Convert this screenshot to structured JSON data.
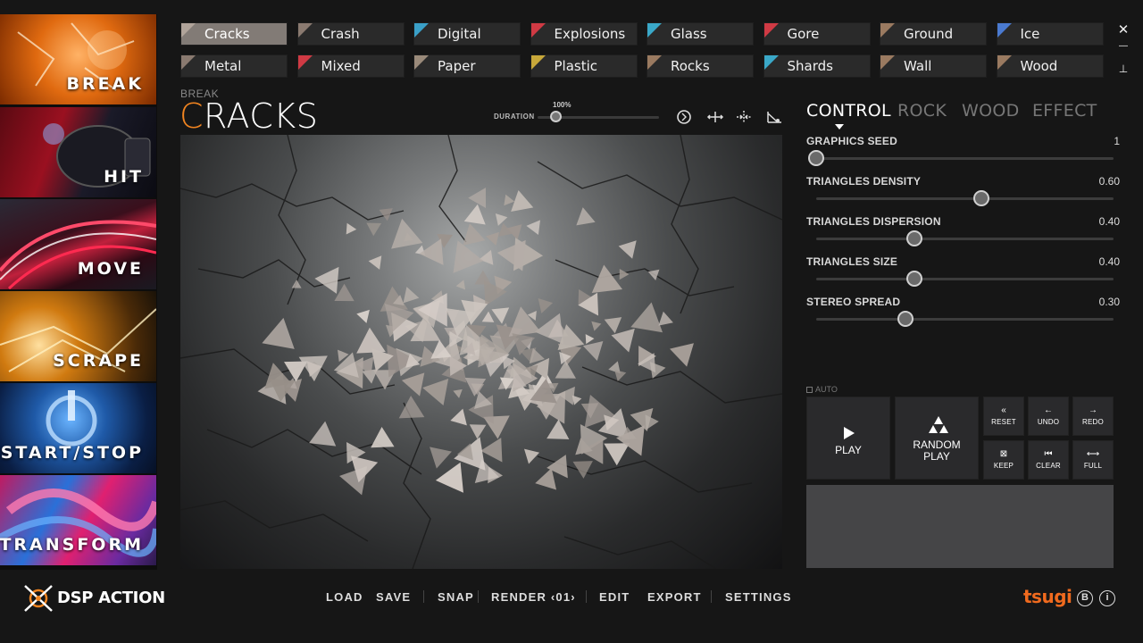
{
  "sidebar": {
    "categories": [
      {
        "label": "BREAK"
      },
      {
        "label": "HIT"
      },
      {
        "label": "MOVE"
      },
      {
        "label": "SCRAPE"
      },
      {
        "label": "START/STOP"
      },
      {
        "label": "TRANSFORM"
      }
    ]
  },
  "presets": [
    {
      "label": "Cracks",
      "color": "#b0a49a",
      "active": true
    },
    {
      "label": "Crash",
      "color": "#8a7a70"
    },
    {
      "label": "Digital",
      "color": "#3aa0c8"
    },
    {
      "label": "Explosions",
      "color": "#d03a44"
    },
    {
      "label": "Glass",
      "color": "#3aa8c8"
    },
    {
      "label": "Gore",
      "color": "#d03a44"
    },
    {
      "label": "Ground",
      "color": "#9a7a60"
    },
    {
      "label": "Ice",
      "color": "#4a7ad0"
    },
    {
      "label": "Metal",
      "color": "#8a7a70"
    },
    {
      "label": "Mixed",
      "color": "#d03a44"
    },
    {
      "label": "Paper",
      "color": "#9a8a7a"
    },
    {
      "label": "Plastic",
      "color": "#c8a83a"
    },
    {
      "label": "Rocks",
      "color": "#9a7a60"
    },
    {
      "label": "Shards",
      "color": "#3aa8c8"
    },
    {
      "label": "Wall",
      "color": "#9a7a60"
    },
    {
      "label": "Wood",
      "color": "#9a7a60"
    }
  ],
  "window": {
    "close": "✕",
    "maximize": "—",
    "pin": "⊥"
  },
  "header": {
    "breadcrumb": "BREAK",
    "title_first": "C",
    "title_rest": "RACKS",
    "duration_label": "DURATION",
    "duration_value": "100%",
    "duration_fraction": 0.15
  },
  "right_panel": {
    "tabs": [
      "CONTROL",
      "ROCK",
      "WOOD",
      "EFFECT"
    ],
    "active_tab": "CONTROL",
    "params": [
      {
        "label": "GRAPHICS SEED",
        "value": "1",
        "fraction": 0.0
      },
      {
        "label": "TRIANGLES DENSITY",
        "value": "0.60",
        "fraction": 0.555
      },
      {
        "label": "TRIANGLES DISPERSION",
        "value": "0.40",
        "fraction": 0.33
      },
      {
        "label": "TRIANGLES SIZE",
        "value": "0.40",
        "fraction": 0.33
      },
      {
        "label": "STEREO SPREAD",
        "value": "0.30",
        "fraction": 0.3
      }
    ],
    "auto_label": "AUTO",
    "buttons": {
      "play": "PLAY",
      "random_play_1": "RANDOM",
      "random_play_2": "PLAY",
      "reset": "RESET",
      "undo": "UNDO",
      "redo": "REDO",
      "keep": "KEEP",
      "clear": "CLEAR",
      "full": "FULL"
    }
  },
  "bottom_bar": {
    "app_name": "DSP ACTION",
    "menu": {
      "load": "LOAD",
      "save": "SAVE",
      "snap": "SNAP",
      "render": "RENDER ‹01›",
      "edit": "EDIT",
      "export": "EXPORT",
      "settings": "SETTINGS"
    },
    "brand": "tsugi"
  },
  "colors": {
    "accent": "#f08420",
    "brand": "#f06a1e",
    "active_preset": "#827b76"
  }
}
